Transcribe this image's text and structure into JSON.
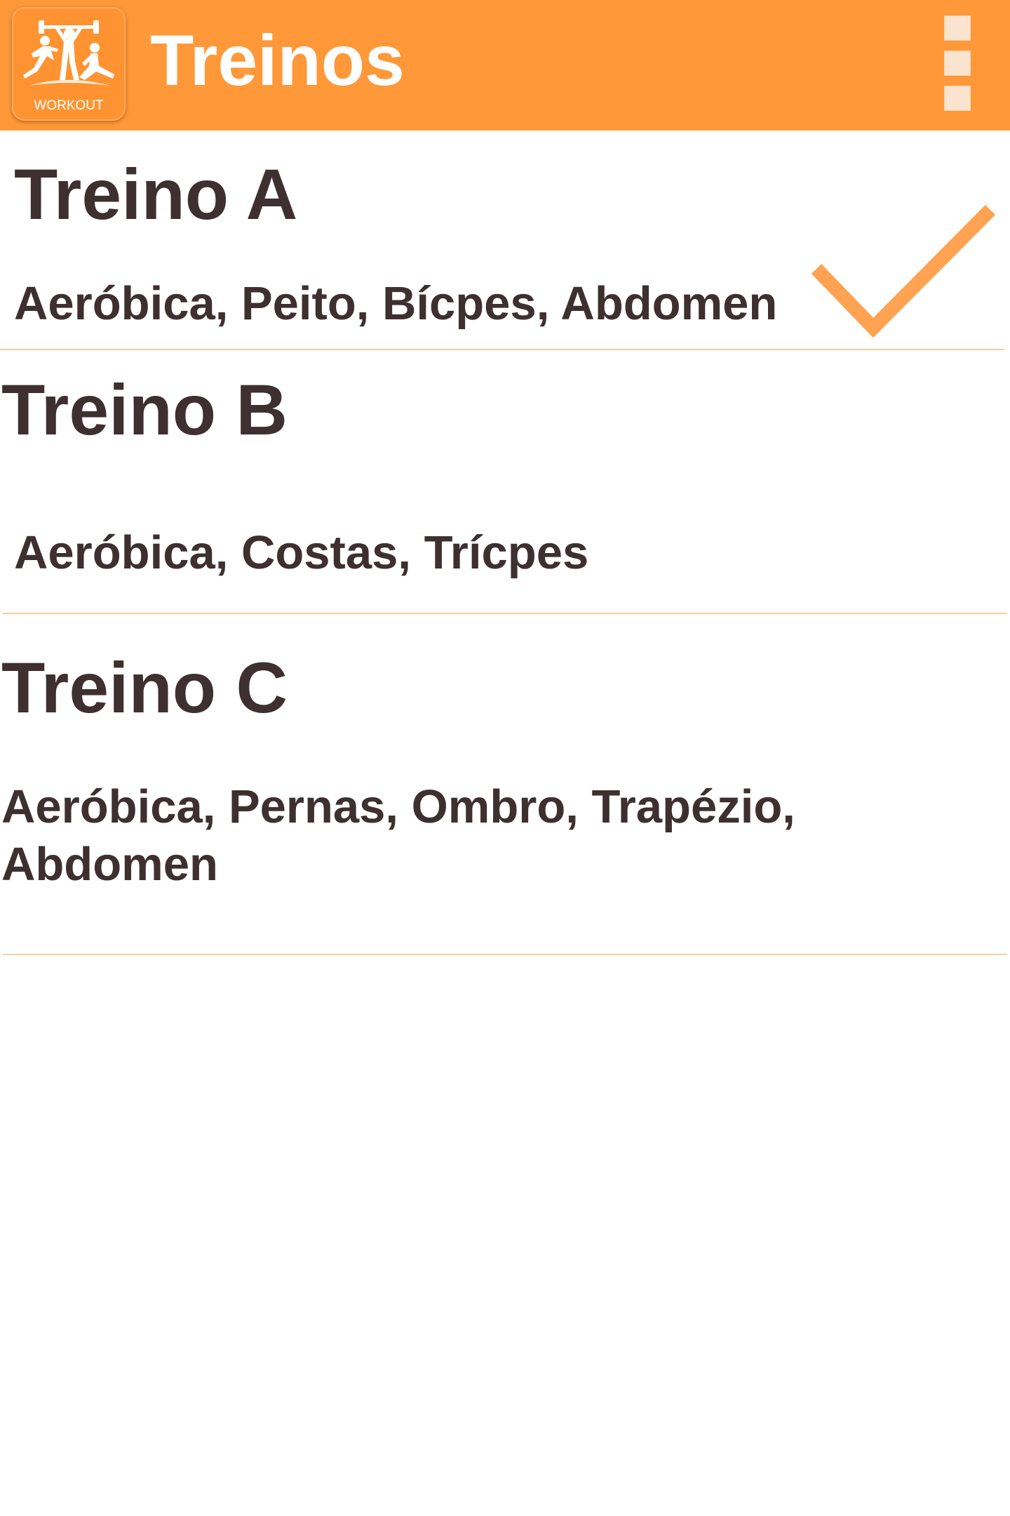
{
  "app_bar": {
    "title": "Treinos",
    "logo_text": "WORKOUT",
    "logo_icon": "workout-figures-icon",
    "menu_icon": "overflow-menu-icon",
    "background_color": "#ff9838"
  },
  "workouts": [
    {
      "name": "Treino A",
      "exercises": "Aeróbica, Peito, Bícpes, Abdomen",
      "selected": true
    },
    {
      "name": "Treino B",
      "exercises": "Aeróbica, Costas, Trícpes",
      "selected": false
    },
    {
      "name": "Treino C",
      "exercises": "Aeróbica, Pernas, Ombro, Trapézio, Abdomen",
      "selected": false
    }
  ],
  "colors": {
    "accent": "#ff9838",
    "check": "#ffa352",
    "text": "#3e2f30",
    "divider": "#f5cfa2"
  },
  "icons": {
    "selected_indicator": "checkmark-icon"
  }
}
